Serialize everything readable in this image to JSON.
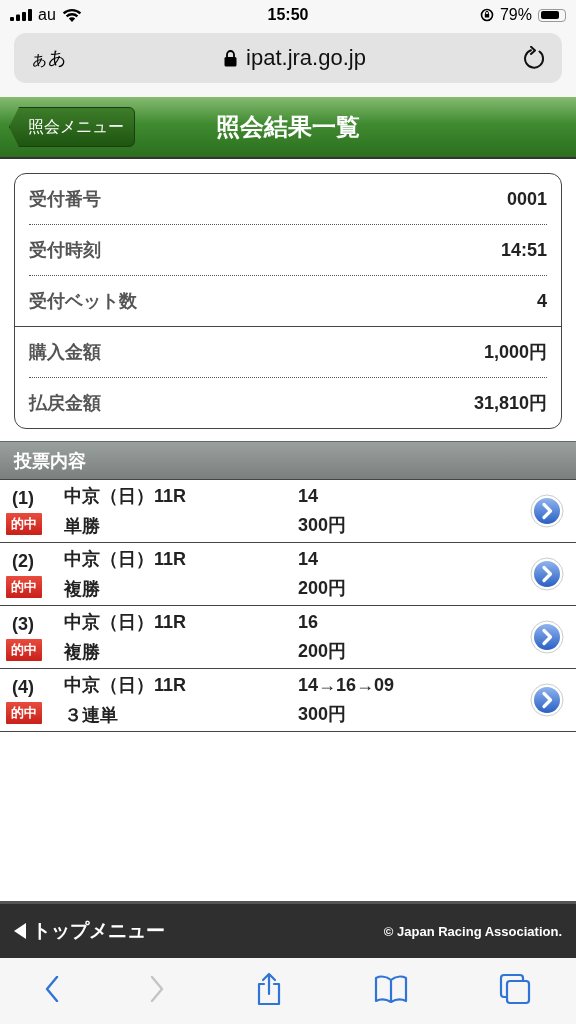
{
  "status_bar": {
    "carrier": "au",
    "time": "15:50",
    "battery": "79%"
  },
  "url_bar": {
    "text_size": "ぁあ",
    "address": "ipat.jra.go.jp"
  },
  "header": {
    "back_button": "照会メニュー",
    "title": "照会結果一覧"
  },
  "summary": {
    "groups": [
      [
        {
          "label": "受付番号",
          "value": "0001"
        },
        {
          "label": "受付時刻",
          "value": "14:51"
        },
        {
          "label": "受付ベット数",
          "value": "4"
        }
      ],
      [
        {
          "label": "購入金額",
          "value": "1,000円"
        },
        {
          "label": "払戻金額",
          "value": "31,810円"
        }
      ]
    ]
  },
  "bets_section": {
    "title": "投票内容",
    "bets": [
      {
        "number": "(1)",
        "race": "中京（日）11R",
        "badge": "的中",
        "bet_type": "単勝",
        "horses": "14",
        "amount": "300円"
      },
      {
        "number": "(2)",
        "race": "中京（日）11R",
        "badge": "的中",
        "bet_type": "複勝",
        "horses": "14",
        "amount": "200円"
      },
      {
        "number": "(3)",
        "race": "中京（日）11R",
        "badge": "的中",
        "bet_type": "複勝",
        "horses": "16",
        "amount": "200円"
      },
      {
        "number": "(4)",
        "race": "中京（日）11R",
        "badge": "的中",
        "bet_type": "３連単",
        "horses": "14→16→09",
        "amount": "300円"
      }
    ]
  },
  "footer": {
    "top_menu": "トップメニュー",
    "copyright": "© Japan Racing Association."
  },
  "browser_toolbar": {
    "back": {
      "disabled": false
    },
    "forward": {
      "disabled": true
    }
  }
}
